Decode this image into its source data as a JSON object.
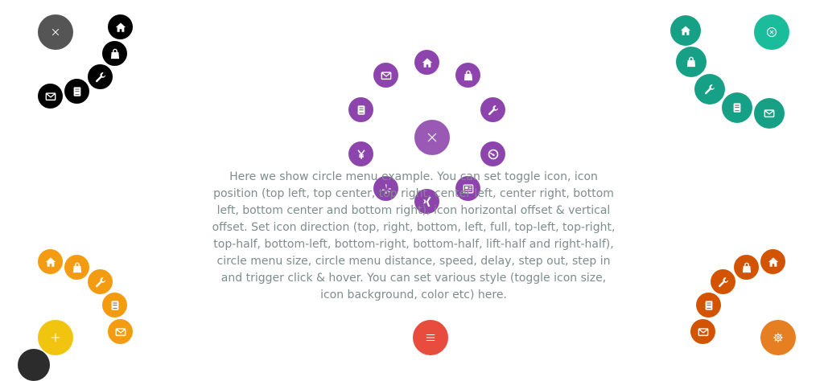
{
  "description": "Here we show circle menu example. You can set toggle icon, icon position (top left, top center, top right, center left, center right, bottom left, bottom center and bottom right), icon horizontal offset & vertical offset. Set icon direction (top, right, bottom, left, full, top-left, top-right, top-half, bottom-left, bottom-right, bottom-half, lift-half and right-half), circle menu size, circle menu distance, speed, delay, step out, step in and trigger click & hover. You can set various style (toggle icon size, icon background, color etc) here.",
  "colors": {
    "dark_toggle": "#555555",
    "purple": "#8e44ad",
    "purple_toggle": "#9b59b6",
    "teal": "#16a085",
    "teal_toggle": "#1abc9c",
    "yellow_items": "#f39c12",
    "yellow_toggle": "#f1c40f",
    "orange_items": "#d35400",
    "orange_toggle": "#e67e22",
    "red_toggle": "#e74c3c",
    "black_items": "#000000",
    "text": "#7f8c8d"
  },
  "menus": {
    "top_left": {
      "toggle_icon": "close-icon",
      "items": [
        "home-icon",
        "bag-icon",
        "wrench-icon",
        "book-icon",
        "envelope-icon"
      ]
    },
    "center": {
      "toggle_icon": "close-icon",
      "items": [
        "home-icon",
        "bag-icon",
        "wrench-icon",
        "dashboard-icon",
        "news-icon",
        "xing-icon",
        "yelp-icon",
        "yen-icon",
        "book-icon",
        "envelope-icon"
      ]
    },
    "top_right": {
      "toggle_icon": "close-circle-icon",
      "items": [
        "home-icon",
        "bag-icon",
        "wrench-icon",
        "book-icon",
        "envelope-icon"
      ]
    },
    "bottom_left": {
      "toggle_icon": "plus-icon",
      "items": [
        "home-icon",
        "bag-icon",
        "wrench-icon",
        "book-icon",
        "envelope-icon"
      ]
    },
    "bottom_center": {
      "toggle_icon": "menu-icon",
      "items": []
    },
    "bottom_right": {
      "toggle_icon": "gear-icon",
      "items": [
        "home-icon",
        "bag-icon",
        "wrench-icon",
        "book-icon",
        "envelope-icon"
      ]
    }
  }
}
